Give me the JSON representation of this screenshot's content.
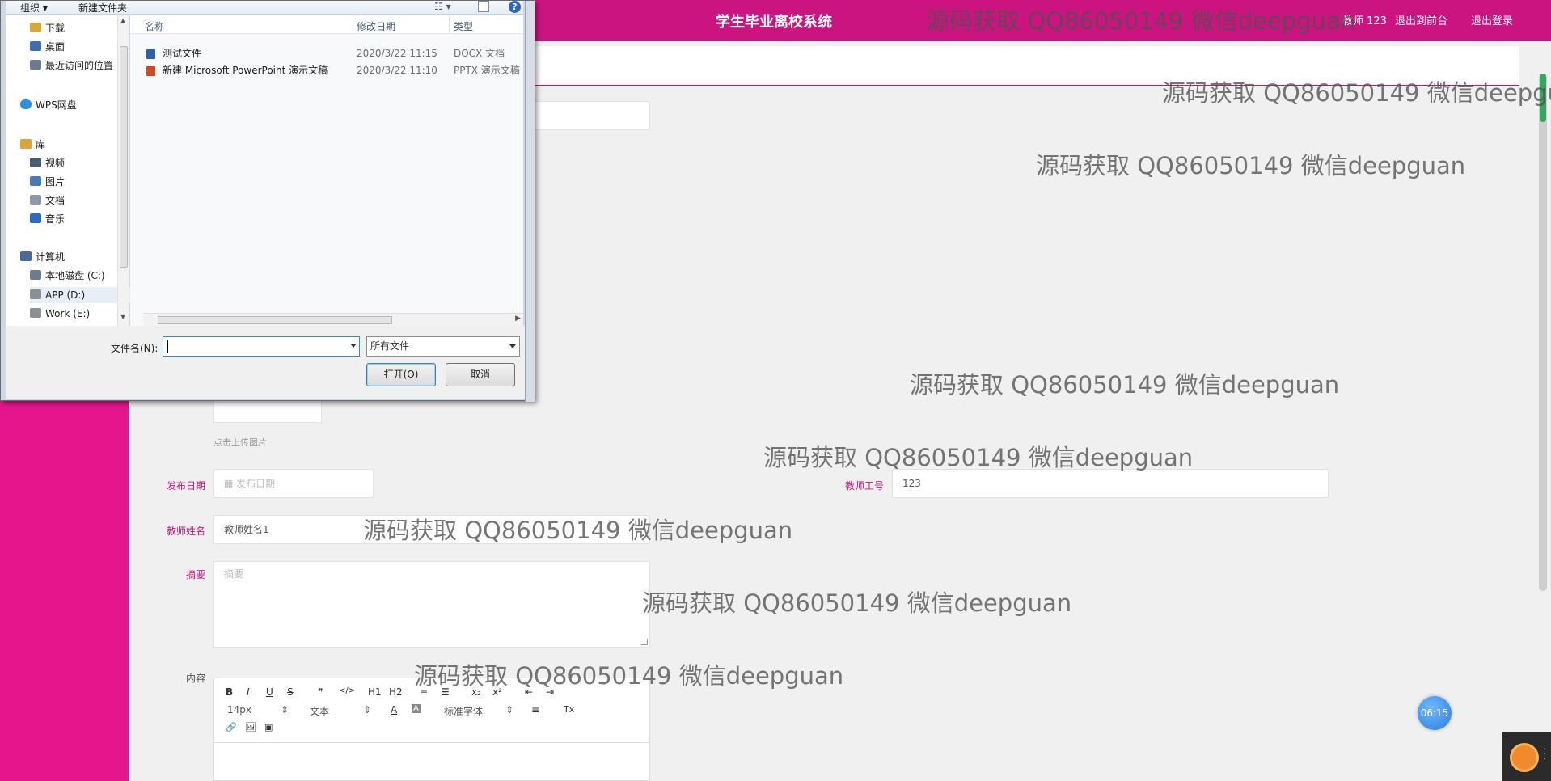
{
  "header": {
    "title": "学生毕业离校系统",
    "user_label": "教师 123",
    "logout_front": "退出到前台",
    "logout": "退出登录"
  },
  "form": {
    "upload_hint": "点击上传图片",
    "publish_date_label": "发布日期",
    "publish_date_placeholder": "发布日期",
    "teacher_id_label": "教师工号",
    "teacher_id_value": "123",
    "teacher_name_label": "教师姓名",
    "teacher_name_value": "教师姓名1",
    "summary_label": "摘要",
    "summary_placeholder": "摘要",
    "content_label": "内容"
  },
  "editor_toolbar": {
    "bold": "B",
    "italic": "I",
    "underline": "U",
    "strike": "S",
    "quote": "❞",
    "code": "</>",
    "h1": "H1",
    "h2": "H2",
    "ordered_list": "≡",
    "bullet_list": "☰",
    "subscript": "x₂",
    "superscript": "x²",
    "outdent": "⇤",
    "indent": "⇥",
    "font_size": "14px",
    "text_style": "文本",
    "font_color": "A",
    "bg_color": "A",
    "font_family": "标准字体",
    "align": "≡",
    "clean": "Tx",
    "link": "🔗",
    "image": "🖼",
    "video": "▣"
  },
  "timer": "06:15",
  "watermark": "源码获取 QQ86050149 微信deepguan",
  "file_dialog": {
    "organize": "组织 ▾",
    "new_folder": "新建文件夹",
    "view_icon": "☷ ▾",
    "help": "?",
    "nav_items": [
      {
        "label": "下载",
        "icon": "download-folder-icon",
        "color": "#d9a63a"
      },
      {
        "label": "桌面",
        "icon": "desktop-icon",
        "color": "#3d6fb7"
      },
      {
        "label": "最近访问的位置",
        "icon": "recent-places-icon",
        "color": "#6b7a8c"
      },
      {
        "label": "WPS网盘",
        "icon": "cloud-icon",
        "color": "#2f8de4"
      },
      {
        "label": "库",
        "icon": "library-icon",
        "color": "#d9a63a"
      },
      {
        "label": "视频",
        "icon": "video-library-icon",
        "color": "#4a5b74"
      },
      {
        "label": "图片",
        "icon": "pictures-library-icon",
        "color": "#4a7bb6"
      },
      {
        "label": "文档",
        "icon": "documents-library-icon",
        "color": "#8d99a8"
      },
      {
        "label": "音乐",
        "icon": "music-library-icon",
        "color": "#2f6bc2"
      },
      {
        "label": "计算机",
        "icon": "computer-icon",
        "color": "#4a6a96"
      },
      {
        "label": "本地磁盘 (C:)",
        "icon": "drive-c-icon",
        "color": "#6d7b8a"
      },
      {
        "label": "APP (D:)",
        "icon": "drive-icon",
        "color": "#8a8f96"
      },
      {
        "label": "Work (E:)",
        "icon": "drive-icon",
        "color": "#8a8f96"
      }
    ],
    "columns": {
      "name": "名称",
      "modified": "修改日期",
      "type": "类型"
    },
    "files": [
      {
        "name": "测试文件",
        "modified": "2020/3/22 11:15",
        "type": "DOCX 文档",
        "icon": "docx-icon",
        "color": "#2b5fb4"
      },
      {
        "name": "新建 Microsoft PowerPoint 演示文稿",
        "modified": "2020/3/22 11:10",
        "type": "PPTX 演示文稿",
        "icon": "pptx-icon",
        "color": "#d24726"
      }
    ],
    "filename_label": "文件名(N):",
    "filename_value": "",
    "filetype_value": "所有文件",
    "open_button": "打开(O)",
    "cancel_button": "取消"
  },
  "colors": {
    "brand": "#cc1480",
    "sidebar": "#e5158c",
    "label": "#c8157f"
  }
}
